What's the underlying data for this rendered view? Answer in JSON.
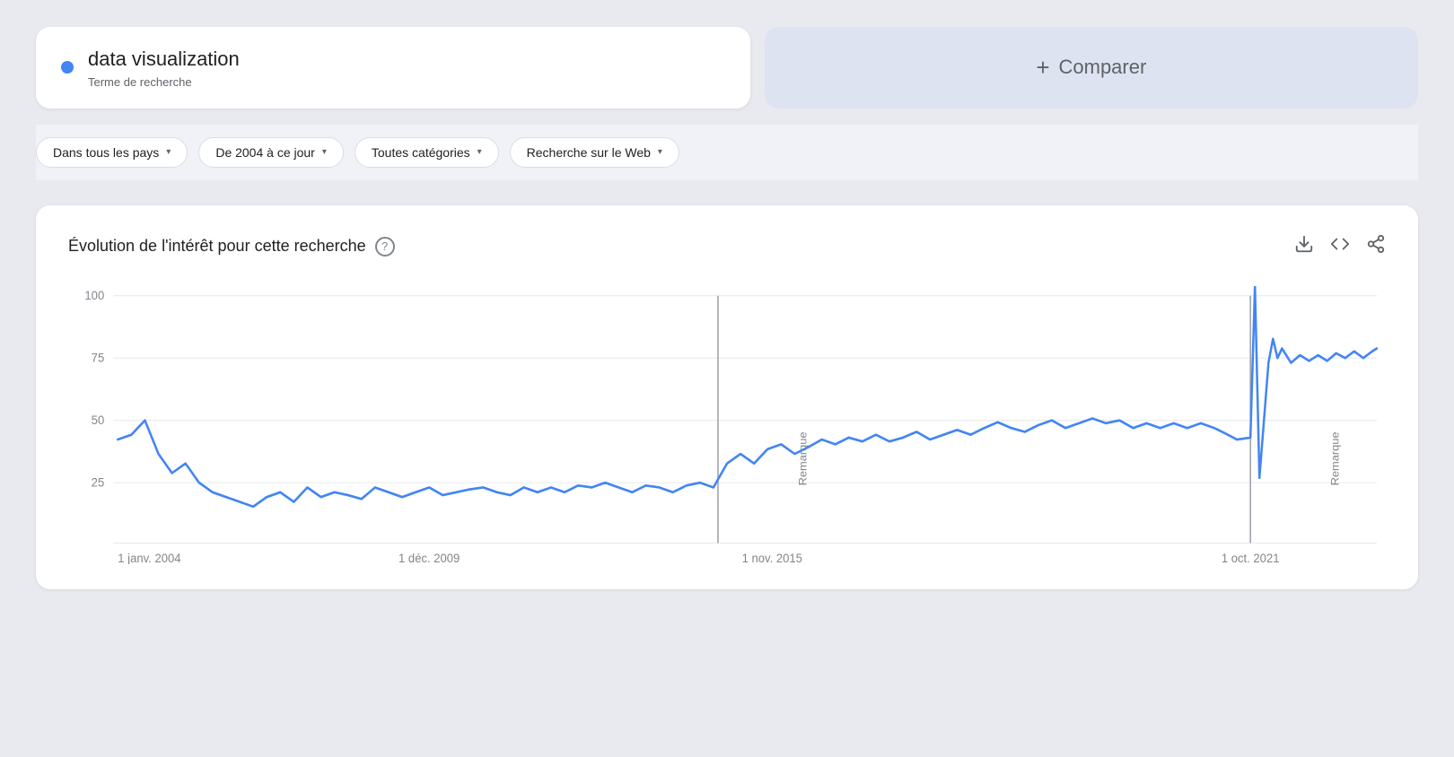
{
  "search": {
    "term": "data visualization",
    "subtitle": "Terme de recherche",
    "dot_color": "#4285f4"
  },
  "compare": {
    "label": "Comparer",
    "plus": "+"
  },
  "filters": [
    {
      "id": "country",
      "label": "Dans tous les pays"
    },
    {
      "id": "period",
      "label": "De 2004 à ce jour"
    },
    {
      "id": "category",
      "label": "Toutes catégories"
    },
    {
      "id": "type",
      "label": "Recherche sur le Web"
    }
  ],
  "chart": {
    "title": "Évolution de l'intérêt pour cette recherche",
    "help": "?",
    "download_icon": "⬇",
    "embed_icon": "<>",
    "share_icon": "↗",
    "y_labels": [
      "100",
      "75",
      "50",
      "25"
    ],
    "x_labels": [
      "1 janv. 2004",
      "1 déc. 2009",
      "1 nov. 2015",
      "1 oct. 2021"
    ],
    "remarque1": "Remarque",
    "remarque2": "Remarque"
  }
}
